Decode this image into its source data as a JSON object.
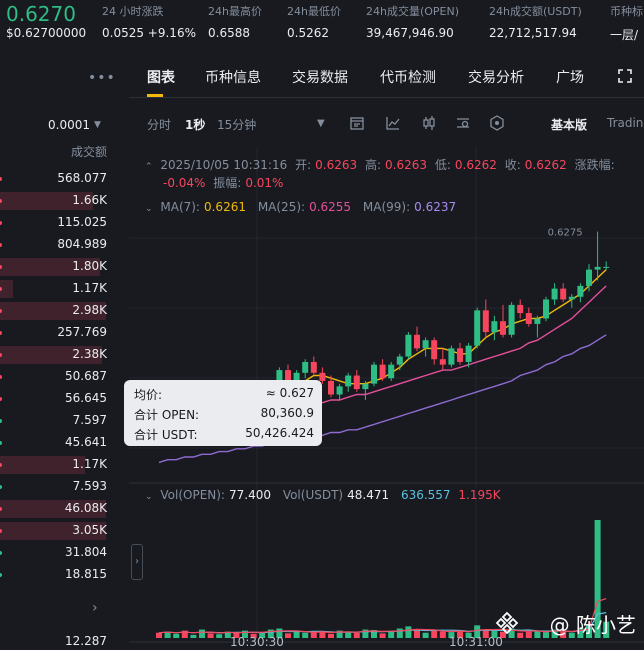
{
  "header": {
    "last_price": "0.6270",
    "last_price_fiat": "$0.62700000",
    "change_label": "24 小时涨跌",
    "change_value": "0.0525 +9.16%",
    "high_label": "24h最高价",
    "high_value": "0.6588",
    "low_label": "24h最低价",
    "low_value": "0.5262",
    "vol_base_label": "24h成交量(OPEN)",
    "vol_base_value": "39,467,946.90",
    "vol_quote_label": "24h成交额(USDT)",
    "vol_quote_value": "22,712,517.94",
    "tag_label": "币种标",
    "tag_value": "一层/"
  },
  "orderbook": {
    "precision": "0.0001",
    "column_header": "成交额",
    "rows": [
      {
        "value": "568.077",
        "side": "sell",
        "depth": 0.0
      },
      {
        "value": "1.66K",
        "side": "sell",
        "depth": 0.88
      },
      {
        "value": "115.025",
        "side": "sell",
        "depth": 0.0
      },
      {
        "value": "804.989",
        "side": "sell",
        "depth": 0.0
      },
      {
        "value": "1.80K",
        "side": "sell",
        "depth": 0.94
      },
      {
        "value": "1.17K",
        "side": "sell",
        "depth": 0.12
      },
      {
        "value": "2.98K",
        "side": "sell",
        "depth": 1.0
      },
      {
        "value": "257.769",
        "side": "sell",
        "depth": 0.0
      },
      {
        "value": "2.38K",
        "side": "sell",
        "depth": 0.96
      },
      {
        "value": "50.687",
        "side": "sell",
        "depth": 0.0
      },
      {
        "value": "56.645",
        "side": "sell",
        "depth": 0.0
      },
      {
        "value": "7.597",
        "side": "buy",
        "depth": 0.0
      },
      {
        "value": "45.641",
        "side": "buy",
        "depth": 0.0
      },
      {
        "value": "1.17K",
        "side": "sell",
        "depth": 0.8
      },
      {
        "value": "7.593",
        "side": "buy",
        "depth": 0.0
      },
      {
        "value": "46.08K",
        "side": "sell",
        "depth": 1.0
      },
      {
        "value": "3.05K",
        "side": "sell",
        "depth": 1.0
      },
      {
        "value": "31.804",
        "side": "buy",
        "depth": 0.0
      },
      {
        "value": "18.815",
        "side": "buy",
        "depth": 0.0
      }
    ],
    "last_value": "12.287"
  },
  "tabs": [
    "图表",
    "币种信息",
    "交易数据",
    "代币检测",
    "交易分析",
    "广场"
  ],
  "toolbar": {
    "intervals": [
      "分时",
      "1秒",
      "15分钟"
    ],
    "active_interval": "1秒",
    "version_label": "基本版",
    "tradingview_label": "Tradin"
  },
  "ohlc": {
    "timestamp": "2025/10/05 10:31:16",
    "open_label": "开:",
    "open": "0.6263",
    "high_label": "高:",
    "high": "0.6263",
    "low_label": "低:",
    "low": "0.6262",
    "close_label": "收:",
    "close": "0.6262",
    "change_label": "涨跌幅:",
    "change": "-0.04%",
    "amp_label": "振幅:",
    "amp": "0.01%"
  },
  "ma": {
    "ma7_label": "MA(7):",
    "ma7": "0.6261",
    "ma25_label": "MA(25):",
    "ma25": "0.6255",
    "ma99_label": "MA(99):",
    "ma99": "0.6237"
  },
  "peak_label": "0.6275",
  "volume": {
    "base_label": "Vol(OPEN):",
    "base_value": "77.400",
    "quote_label": "Vol(USDT)",
    "quote_value": "48.471",
    "ma_a": "636.557",
    "ma_b": "1.195K"
  },
  "time_axis": [
    "10:30:30",
    "10:31:00"
  ],
  "tooltip": {
    "avg_label": "均价:",
    "avg_value": "≈ 0.627",
    "sum_base_label": "合计 OPEN:",
    "sum_base_value": "80,360.9",
    "sum_quote_label": "合计 USDT:",
    "sum_quote_value": "50,426.424"
  },
  "watermark": "@ 陈小艺",
  "colors": {
    "up": "#2ebd85",
    "down": "#f6465d",
    "ma7": "#f0b90b",
    "ma25": "#e44f9a",
    "ma99": "#8e6bd1",
    "accent": "#f0b90b"
  },
  "chart_data": {
    "type": "candlestick",
    "price_range": [
      0.6185,
      0.628
    ],
    "candles": [
      [
        0.62,
        0.6202,
        0.6198,
        0.6199
      ],
      [
        0.6199,
        0.6203,
        0.6197,
        0.6202
      ],
      [
        0.6202,
        0.6206,
        0.6201,
        0.6205
      ],
      [
        0.6205,
        0.6207,
        0.6202,
        0.6203
      ],
      [
        0.6203,
        0.6208,
        0.6202,
        0.6207
      ],
      [
        0.6207,
        0.6212,
        0.6205,
        0.6211
      ],
      [
        0.6211,
        0.6213,
        0.6207,
        0.6208
      ],
      [
        0.6208,
        0.6211,
        0.6206,
        0.621
      ],
      [
        0.621,
        0.6216,
        0.6209,
        0.6215
      ],
      [
        0.6215,
        0.6217,
        0.6211,
        0.6212
      ],
      [
        0.6212,
        0.6216,
        0.621,
        0.6214
      ],
      [
        0.6214,
        0.6215,
        0.6208,
        0.6209
      ],
      [
        0.6209,
        0.6213,
        0.6207,
        0.6212
      ],
      [
        0.6212,
        0.6218,
        0.6211,
        0.6217
      ],
      [
        0.6217,
        0.6225,
        0.6215,
        0.6224
      ],
      [
        0.6224,
        0.6226,
        0.6219,
        0.622
      ],
      [
        0.622,
        0.6224,
        0.6218,
        0.6223
      ],
      [
        0.6223,
        0.6228,
        0.6221,
        0.6227
      ],
      [
        0.6227,
        0.6229,
        0.6222,
        0.6223
      ],
      [
        0.6223,
        0.6225,
        0.6219,
        0.622
      ],
      [
        0.622,
        0.6222,
        0.6214,
        0.6215
      ],
      [
        0.6215,
        0.6219,
        0.6213,
        0.6218
      ],
      [
        0.6218,
        0.6223,
        0.6216,
        0.6222
      ],
      [
        0.6222,
        0.6224,
        0.6216,
        0.6217
      ],
      [
        0.6217,
        0.622,
        0.6213,
        0.6219
      ],
      [
        0.6219,
        0.6227,
        0.6218,
        0.6226
      ],
      [
        0.6226,
        0.6228,
        0.622,
        0.6221
      ],
      [
        0.6221,
        0.6227,
        0.622,
        0.6226
      ],
      [
        0.6226,
        0.623,
        0.6224,
        0.6229
      ],
      [
        0.6229,
        0.6238,
        0.6228,
        0.6237
      ],
      [
        0.6237,
        0.624,
        0.6231,
        0.6232
      ],
      [
        0.6232,
        0.6236,
        0.6229,
        0.6235
      ],
      [
        0.6235,
        0.6236,
        0.6226,
        0.6228
      ],
      [
        0.6228,
        0.6232,
        0.6224,
        0.6226
      ],
      [
        0.6226,
        0.6233,
        0.6225,
        0.6232
      ],
      [
        0.6232,
        0.6234,
        0.6226,
        0.6227
      ],
      [
        0.6227,
        0.6234,
        0.6225,
        0.6233
      ],
      [
        0.6233,
        0.6247,
        0.6232,
        0.6246
      ],
      [
        0.6246,
        0.625,
        0.6236,
        0.6238
      ],
      [
        0.6238,
        0.6244,
        0.6235,
        0.6242
      ],
      [
        0.6242,
        0.6248,
        0.6236,
        0.6237
      ],
      [
        0.6237,
        0.6249,
        0.6236,
        0.6248
      ],
      [
        0.6248,
        0.625,
        0.6243,
        0.6245
      ],
      [
        0.6245,
        0.6247,
        0.624,
        0.6241
      ],
      [
        0.6241,
        0.6244,
        0.6236,
        0.6243
      ],
      [
        0.6243,
        0.6251,
        0.6242,
        0.625
      ],
      [
        0.625,
        0.6256,
        0.6248,
        0.6254
      ],
      [
        0.6254,
        0.6256,
        0.6249,
        0.625
      ],
      [
        0.625,
        0.6252,
        0.6247,
        0.6251
      ],
      [
        0.6251,
        0.6256,
        0.6249,
        0.6255
      ],
      [
        0.6255,
        0.6263,
        0.6253,
        0.6261
      ],
      [
        0.6261,
        0.6275,
        0.6257,
        0.6262
      ],
      [
        0.6262,
        0.6264,
        0.6261,
        0.6262
      ]
    ],
    "ma7": [
      0.62,
      0.6201,
      0.6202,
      0.6203,
      0.6204,
      0.6206,
      0.6207,
      0.6208,
      0.6209,
      0.621,
      0.6211,
      0.6211,
      0.6212,
      0.6213,
      0.6214,
      0.6216,
      0.6218,
      0.622,
      0.6222,
      0.6222,
      0.6221,
      0.622,
      0.6219,
      0.6219,
      0.6219,
      0.622,
      0.6221,
      0.6223,
      0.6225,
      0.6228,
      0.623,
      0.6232,
      0.6232,
      0.6232,
      0.6231,
      0.623,
      0.623,
      0.6233,
      0.6236,
      0.6238,
      0.6239,
      0.6241,
      0.6242,
      0.6243,
      0.6243,
      0.6244,
      0.6246,
      0.6248,
      0.625,
      0.6252,
      0.6255,
      0.6258,
      0.6261
    ],
    "ma25": [
      0.62,
      0.62,
      0.6201,
      0.6201,
      0.6202,
      0.6202,
      0.6203,
      0.6203,
      0.6204,
      0.6205,
      0.6205,
      0.6206,
      0.6207,
      0.6207,
      0.6208,
      0.6209,
      0.621,
      0.6211,
      0.6212,
      0.6212,
      0.6213,
      0.6213,
      0.6214,
      0.6215,
      0.6215,
      0.6216,
      0.6217,
      0.6218,
      0.6219,
      0.622,
      0.6221,
      0.6222,
      0.6223,
      0.6224,
      0.6224,
      0.6225,
      0.6226,
      0.6227,
      0.6228,
      0.6229,
      0.623,
      0.6231,
      0.6232,
      0.6234,
      0.6235,
      0.6237,
      0.6239,
      0.6241,
      0.6243,
      0.6246,
      0.6249,
      0.6252,
      0.6255
    ],
    "ma99": [
      0.619,
      0.6191,
      0.6191,
      0.6192,
      0.6192,
      0.6193,
      0.6193,
      0.6194,
      0.6194,
      0.6195,
      0.6195,
      0.6196,
      0.6196,
      0.6197,
      0.6197,
      0.6198,
      0.6198,
      0.6199,
      0.6199,
      0.62,
      0.6201,
      0.6201,
      0.6202,
      0.6202,
      0.6203,
      0.6204,
      0.6205,
      0.6206,
      0.6207,
      0.6208,
      0.6209,
      0.621,
      0.6211,
      0.6212,
      0.6213,
      0.6214,
      0.6215,
      0.6216,
      0.6217,
      0.6218,
      0.6219,
      0.622,
      0.6222,
      0.6223,
      0.6224,
      0.6226,
      0.6227,
      0.6229,
      0.623,
      0.6232,
      0.6233,
      0.6235,
      0.6237
    ],
    "volumes": [
      25,
      30,
      20,
      35,
      15,
      40,
      22,
      18,
      30,
      25,
      35,
      20,
      28,
      40,
      45,
      22,
      30,
      25,
      32,
      28,
      20,
      35,
      30,
      25,
      40,
      38,
      22,
      30,
      45,
      55,
      35,
      25,
      40,
      30,
      28,
      35,
      25,
      60,
      40,
      35,
      30,
      45,
      25,
      30,
      35,
      28,
      40,
      30,
      25,
      50,
      60,
      560,
      77.4
    ]
  }
}
